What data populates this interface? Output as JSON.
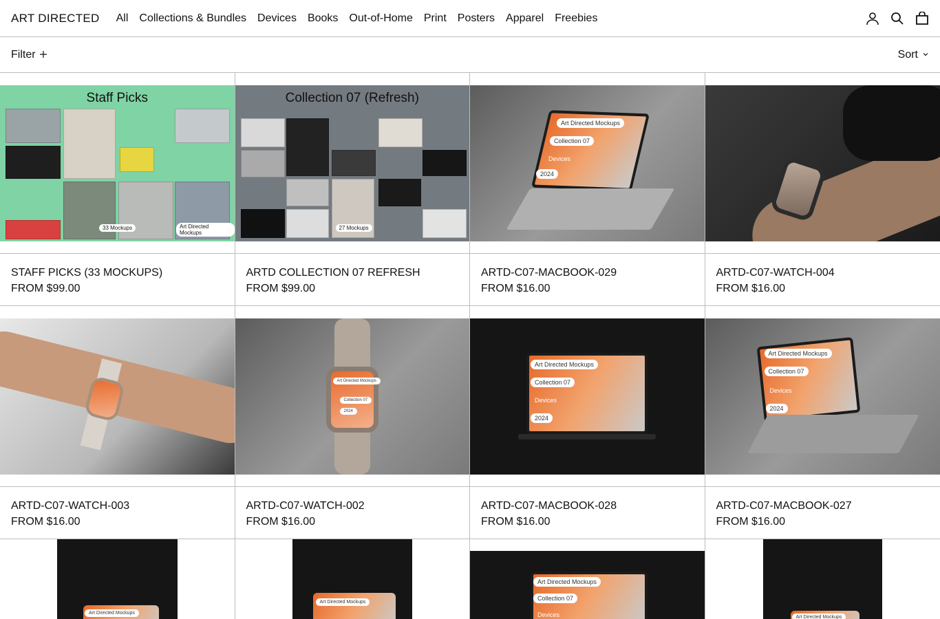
{
  "header": {
    "logo": "ART DIRECTED",
    "nav": [
      "All",
      "Collections & Bundles",
      "Devices",
      "Books",
      "Out-of-Home",
      "Print",
      "Posters",
      "Apparel",
      "Freebies"
    ]
  },
  "toolbar": {
    "filter_label": "Filter",
    "sort_label": "Sort"
  },
  "products": [
    {
      "title": "STAFF PICKS (33 MOCKUPS)",
      "price": "FROM $99.00",
      "tile_title": "Staff Picks",
      "badge": "33 Mockups",
      "badge2": "Art Directed Mockups"
    },
    {
      "title": "ARTD COLLECTION 07 REFRESH",
      "price": "FROM $99.00",
      "tile_title": "Collection 07 (Refresh)",
      "badge": "27 Mockups"
    },
    {
      "title": "ARTD-C07-MACBOOK-029",
      "price": "FROM $16.00",
      "screen": [
        "Art Directed Mockups",
        "Collection 07",
        "Devices",
        "2024"
      ]
    },
    {
      "title": "ARTD-C07-WATCH-004",
      "price": "FROM $16.00"
    },
    {
      "title": "ARTD-C07-WATCH-003",
      "price": "FROM $16.00"
    },
    {
      "title": "ARTD-C07-WATCH-002",
      "price": "FROM $16.00",
      "screen": [
        "Art Directed Mockups",
        "Collection 07",
        "2024"
      ]
    },
    {
      "title": "ARTD-C07-MACBOOK-028",
      "price": "FROM $16.00",
      "screen": [
        "Art Directed Mockups",
        "Collection 07",
        "Devices",
        "2024"
      ]
    },
    {
      "title": "ARTD-C07-MACBOOK-027",
      "price": "FROM $16.00",
      "screen": [
        "Art Directed Mockups",
        "Collection 07",
        "Devices",
        "2024"
      ]
    }
  ],
  "row3": [
    {
      "screen": "Art Directed Mockups"
    },
    {
      "screen": "Art Directed Mockups"
    },
    {
      "screen": [
        "Art Directed Mockups",
        "Collection 07",
        "Devices"
      ]
    },
    {
      "screen": "Art Directed Mockups"
    }
  ]
}
